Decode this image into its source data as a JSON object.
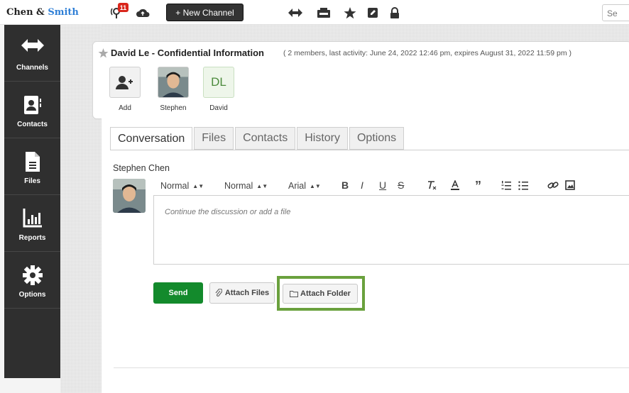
{
  "topbar": {
    "logo_part1": "Chen & ",
    "logo_part2": "Smith",
    "notification_count": "11",
    "new_channel_label": "+ New Channel",
    "search_placeholder": "Se"
  },
  "sidebar": {
    "items": [
      {
        "label": "Channels",
        "icon": "channels-icon"
      },
      {
        "label": "Contacts",
        "icon": "contacts-icon"
      },
      {
        "label": "Files",
        "icon": "files-icon"
      },
      {
        "label": "Reports",
        "icon": "reports-icon"
      },
      {
        "label": "Options",
        "icon": "options-icon"
      }
    ]
  },
  "channel": {
    "title": "David Le - Confidential Information",
    "meta": "( 2 members, last activity: June 24, 2022 12:46 pm, expires August 31, 2022 11:59 pm )",
    "members": [
      {
        "name": "Add"
      },
      {
        "name": "Stephen"
      },
      {
        "name": "David",
        "initials": "DL"
      }
    ]
  },
  "tabs": [
    "Conversation",
    "Files",
    "Contacts",
    "History",
    "Options"
  ],
  "active_tab": "Conversation",
  "composer": {
    "author": "Stephen Chen",
    "toolbar": {
      "heading": "Normal",
      "size": "Normal",
      "font": "Arial",
      "bold": "B",
      "italic": "I",
      "underline": "U",
      "strike": "S",
      "quote": "”"
    },
    "placeholder": "Continue the discussion or add a file",
    "send_label": "Send",
    "attach_files_label": "Attach Files",
    "attach_folder_label": "Attach Folder"
  },
  "colors": {
    "sidebar_bg": "#2f2f2f",
    "send_green": "#138a2c",
    "highlight": "#6aa13d",
    "brand_blue": "#2f7fd6"
  }
}
